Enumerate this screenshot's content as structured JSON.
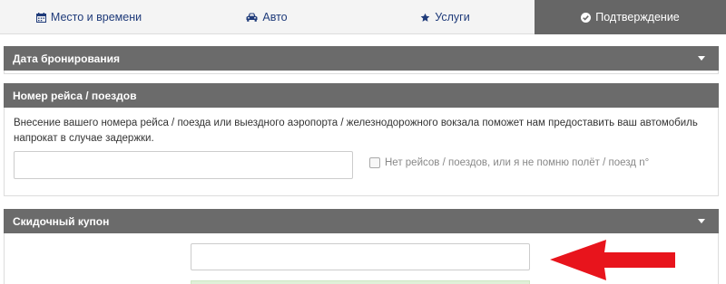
{
  "tabs": [
    {
      "label": "Место и времени",
      "icon": "calendar-icon"
    },
    {
      "label": "Авто",
      "icon": "car-icon"
    },
    {
      "label": "Услуги",
      "icon": "star-icon"
    },
    {
      "label": "Подтверждение",
      "icon": "check-circle-icon",
      "active": true
    }
  ],
  "panels": {
    "booking_date": {
      "title": "Дата бронирования"
    },
    "flight": {
      "title": "Номер рейса / поездов",
      "description": "Внесение вашего номера рейса / поезда или выездного аэропорта / железнодорожного вокзала поможет нам предоставить ваш автомобиль напрокат в случае задержки.",
      "input_value": "",
      "no_flight_label": "Нет рейсов / поездов, или я не помню полёт / поезд n°",
      "no_flight_checked": false
    },
    "coupon": {
      "title": "Скидочный купон",
      "input_value": ""
    }
  },
  "colors": {
    "tab_text": "#1f3b7a",
    "active_tab_bg": "#666666",
    "panel_header_bg": "#6b6b6b",
    "arrow": "#e8141c",
    "success_bg": "#dff0d8"
  }
}
